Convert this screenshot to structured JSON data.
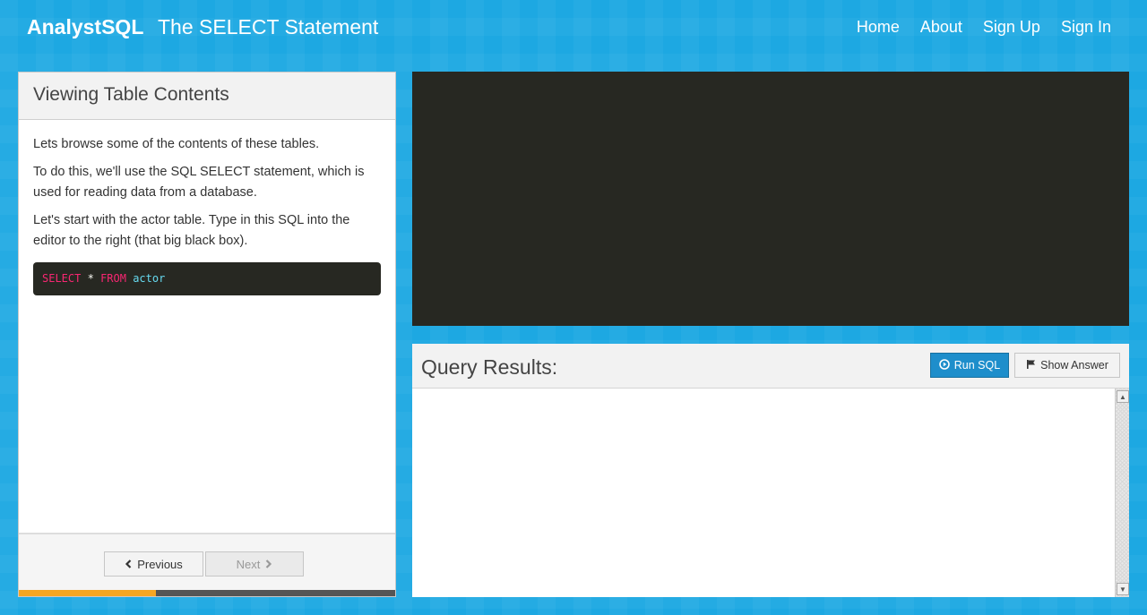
{
  "nav": {
    "brand": "AnalystSQL",
    "page_title": "The SELECT Statement",
    "links": [
      "Home",
      "About",
      "Sign Up",
      "Sign In"
    ]
  },
  "lesson": {
    "title": "Viewing Table Contents",
    "paragraphs": [
      "Lets browse some of the contents of these tables.",
      "To do this, we'll use the SQL SELECT statement, which is used for reading data from a database.",
      "Let's start with the actor table. Type in this SQL into the editor to the right (that big black box)."
    ],
    "code": {
      "kw1": "SELECT",
      "op": "*",
      "kw2": "FROM",
      "table": "actor"
    },
    "prev_label": "Previous",
    "next_label": "Next",
    "progress_fraction": 0.365
  },
  "editor": {
    "content": ""
  },
  "results": {
    "title": "Query Results:",
    "run_label": "Run SQL",
    "answer_label": "Show Answer"
  },
  "colors": {
    "background": "#1da8e2",
    "editor_bg": "#272822",
    "progress_fill": "#f5a623",
    "primary_button": "#1e8ecb"
  },
  "icons": {
    "prev": "chevron-left-icon",
    "next": "chevron-right-icon",
    "run": "play-circle-icon",
    "answer": "flag-icon"
  }
}
